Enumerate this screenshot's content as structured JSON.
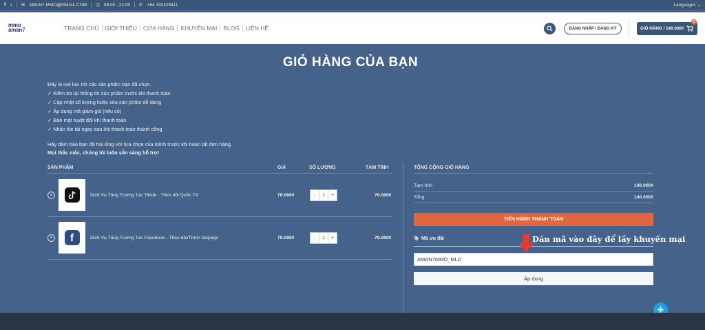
{
  "topbar": {
    "email": "AMAN7.MMO@GMAIL.COM",
    "hours": "08:00 - 22:00",
    "phone": "+84 332429411",
    "languages": "Languages"
  },
  "header": {
    "logo_line1": "mmo",
    "logo_line2": "aman7",
    "nav": [
      "TRANG CHỦ",
      "GIỚI THIỆU",
      "CỬA HÀNG",
      "KHUYẾN MẠI",
      "BLOG",
      "LIÊN HỆ"
    ],
    "login_label": "ĐĂNG NHẬP / ĐĂNG KÝ",
    "cart_label": "GIỎ HÀNG / 140.000₫",
    "cart_count": "2"
  },
  "page": {
    "title": "GIỎ HÀNG CỦA BẠN",
    "intro_lines": [
      "Đây là nơi lưu trữ các sản phẩm bạn đã chọn.",
      "✓ Kiểm tra lại thông tin sản phẩm trước khi thanh toán",
      "✓ Cập nhật số lượng hoặc xóa sản phẩm dễ dàng",
      "✓ Áp dụng mã giảm giá (nếu có)",
      "✓ Bảo mật tuyệt đối khi thanh toán",
      "✓ Nhận file tải ngay sau khi thanh toán thành công"
    ],
    "note_line1": "Hãy đảm bảo bạn đã hài lòng với lựa chọn của mình trước khi hoàn tất đơn hàng.",
    "note_line2": "Mọi thắc mắc, chúng tôi luôn sẵn sàng hỗ trợ!"
  },
  "cart": {
    "col_product": "SẢN PHẨM",
    "col_price": "GIÁ",
    "col_qty": "SỐ LƯỢNG",
    "col_subtotal": "TẠM TÍNH",
    "items": [
      {
        "name": "Dịch Vụ Tăng Tương Tác Tiktok - Theo dõi Quốc Tế",
        "price": "70.000₫",
        "qty": "1",
        "subtotal": "70.000₫",
        "icon": "tiktok-icon"
      },
      {
        "name": "Dịch Vụ Tăng Tương Tác Facebook - Theo dõi/Thích fanpage",
        "price": "70.000₫",
        "qty": "1",
        "subtotal": "70.000₫",
        "icon": "facebook-icon"
      }
    ]
  },
  "totals": {
    "heading": "TỔNG CỘNG GIỎ HÀNG",
    "subtotal_label": "Tạm tính",
    "subtotal_value": "140.000₫",
    "total_label": "Tổng",
    "total_value": "140.000₫",
    "checkout_label": "TIẾN HÀNH THANH TOÁN",
    "coupon_label": "Mã ưu đãi",
    "coupon_value": "AMAN7MMO_MLD",
    "apply_label": "Áp dụng",
    "annotation": "Dán mã vào đây để lấy khuyến mại"
  },
  "colors": {
    "page_bg": "#44628a",
    "accent": "#e0673f",
    "plus_button": "#1f9fe0"
  }
}
